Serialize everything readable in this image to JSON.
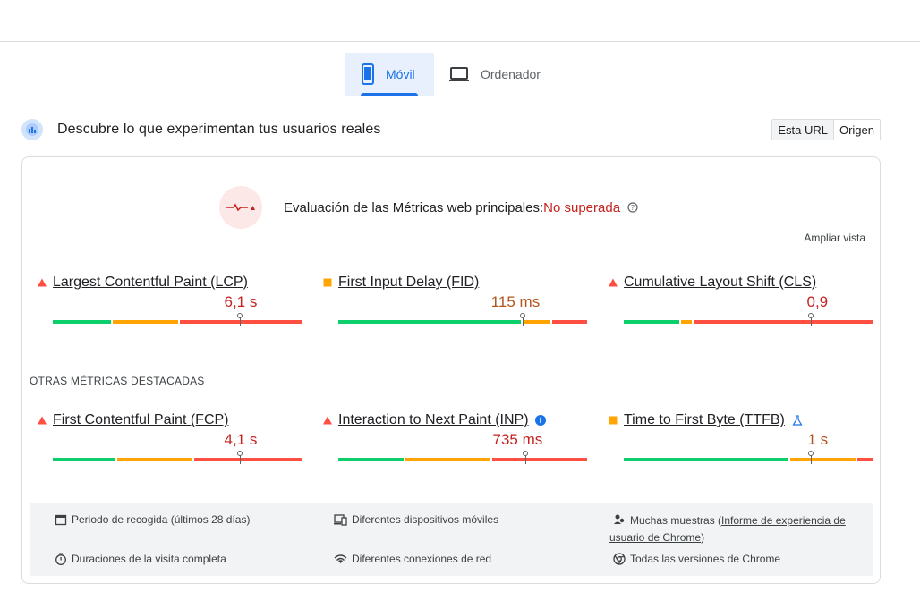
{
  "tabs": [
    {
      "label": "Móvil",
      "icon": "smartphone-icon",
      "active": true
    },
    {
      "label": "Ordenador",
      "icon": "laptop-icon",
      "active": false
    }
  ],
  "section": {
    "title": "Descubre lo que experimentan tus usuarios reales",
    "toggle": [
      "Esta URL",
      "Origen"
    ]
  },
  "verdict": {
    "label": "Evaluación de las Métricas web principales:",
    "status": "No superada"
  },
  "expand_label": "Ampliar vista",
  "other_title": "OTRAS MÉTRICAS DESTACADAS",
  "colors": {
    "good": "#0cce6b",
    "avg": "#ffa400",
    "poor": "#ff4e42",
    "poor_text": "#c5221f",
    "accent": "#1a73e8"
  },
  "core_metrics": [
    {
      "name": "Largest Contentful Paint (LCP)",
      "value": "6,1 s",
      "status": "poor",
      "dist": {
        "good": 24,
        "avg": 27,
        "poor": 49
      },
      "marker": 0.75
    },
    {
      "name": "First Input Delay (FID)",
      "value": "115 ms",
      "status": "avg",
      "dist": {
        "good": 74,
        "avg": 12,
        "poor": 14
      },
      "marker": 0.74
    },
    {
      "name": "Cumulative Layout Shift (CLS)",
      "value": "0,9",
      "status": "poor",
      "dist": {
        "good": 23,
        "avg": 5,
        "poor": 72
      },
      "marker": 0.75
    }
  ],
  "other_metrics": [
    {
      "name": "First Contentful Paint (FCP)",
      "value": "4,1 s",
      "status": "poor",
      "dist": {
        "good": 26,
        "avg": 31,
        "poor": 43
      },
      "marker": 0.75
    },
    {
      "name": "Interaction to Next Paint (INP)",
      "value": "735 ms",
      "status": "poor",
      "dist": {
        "good": 27,
        "avg": 35,
        "poor": 38
      },
      "marker": 0.75,
      "info": true
    },
    {
      "name": "Time to First Byte (TTFB)",
      "value": "1 s",
      "status": "avg",
      "dist": {
        "good": 67,
        "avg": 27,
        "poor": 6
      },
      "marker": 0.75,
      "experimental": true
    }
  ],
  "footer": {
    "collection_period": "Periodo de recogida (últimos 28 días)",
    "devices": "Diferentes dispositivos móviles",
    "samples_prefix": "Muchas muestras (",
    "samples_link_1": "Informe de experiencia de",
    "samples_link_2": "usuario de Chrome",
    "samples_suffix": ")",
    "durations": "Duraciones de la visita completa",
    "connections": "Diferentes conexiones de red",
    "chrome_versions": "Todas las versiones de Chrome"
  }
}
